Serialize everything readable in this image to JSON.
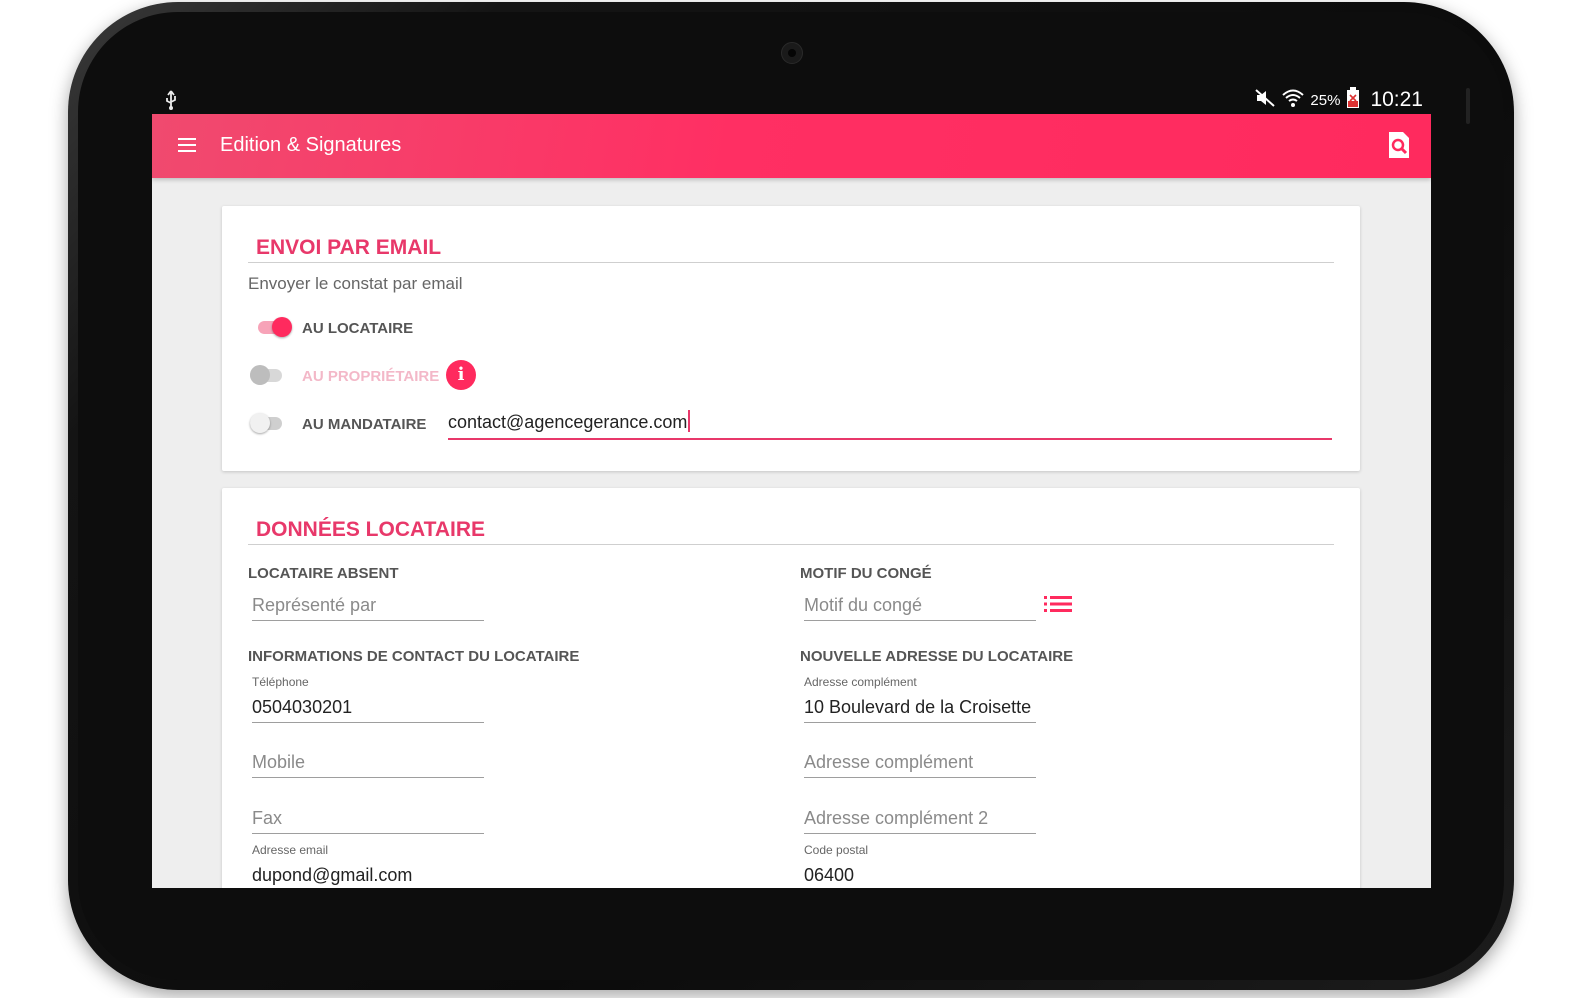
{
  "statusbar": {
    "usb_icon": "usb-icon",
    "battery": "25%",
    "time": "10:21"
  },
  "appbar": {
    "title": "Edition & Signatures",
    "menu_icon": "hamburger-menu-icon",
    "action_icon": "document-search-icon"
  },
  "email_section": {
    "title": "ENVOI PAR EMAIL",
    "subtitle": "Envoyer le constat par email",
    "recipients": [
      {
        "label": "AU LOCATAIRE",
        "enabled": true,
        "checked": true
      },
      {
        "label": "AU PROPRIÉTAIRE",
        "enabled": false,
        "checked": false
      },
      {
        "label": "AU MANDATAIRE",
        "enabled": true,
        "checked": false
      }
    ],
    "info_badge": "i",
    "mandataire_email": "contact@agencegerance.com"
  },
  "tenant_section": {
    "title": "DONNÉES LOCATAIRE",
    "absent": {
      "header": "LOCATAIRE ABSENT",
      "represented_placeholder": "Représenté par"
    },
    "motif": {
      "header": "MOTIF DU CONGÉ",
      "placeholder": "Motif du congé",
      "list_icon": "list-icon"
    },
    "contact": {
      "header": "INFORMATIONS DE CONTACT DU LOCATAIRE",
      "telephone_label": "Téléphone",
      "telephone_value": "0504030201",
      "mobile_placeholder": "Mobile",
      "fax_placeholder": "Fax",
      "email_label": "Adresse email",
      "email_value": "dupond@gmail.com"
    },
    "new_address": {
      "header": "NOUVELLE ADRESSE DU LOCATAIRE",
      "address_label": "Adresse complément",
      "address_value": "10 Boulevard de la Croisette",
      "complement_placeholder": "Adresse complément",
      "complement2_placeholder": "Adresse complément 2",
      "postal_label": "Code postal",
      "postal_value": "06400"
    }
  },
  "colors": {
    "accent": "#ff2a5e",
    "section_title": "#e8386a",
    "background": "#eeeeee"
  }
}
